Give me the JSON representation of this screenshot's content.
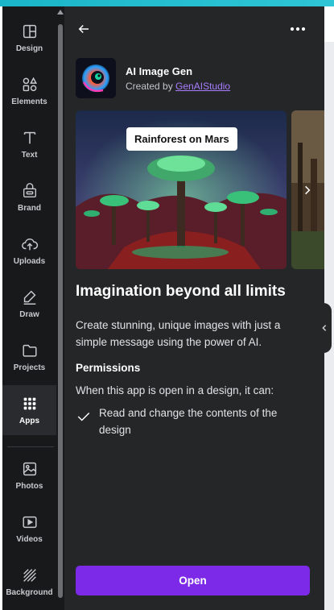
{
  "sidebar": {
    "items": [
      {
        "label": "Design",
        "icon": "layout-icon"
      },
      {
        "label": "Elements",
        "icon": "shapes-icon"
      },
      {
        "label": "Text",
        "icon": "text-t-icon"
      },
      {
        "label": "Brand",
        "icon": "brand-icon"
      },
      {
        "label": "Uploads",
        "icon": "cloud-upload-icon"
      },
      {
        "label": "Draw",
        "icon": "pen-icon"
      },
      {
        "label": "Projects",
        "icon": "folder-icon"
      },
      {
        "label": "Apps",
        "icon": "grid-dots-icon",
        "active": true
      },
      {
        "label": "Photos",
        "icon": "image-icon"
      },
      {
        "label": "Videos",
        "icon": "video-icon"
      },
      {
        "label": "Background",
        "icon": "hatch-icon"
      }
    ]
  },
  "panel": {
    "back_icon": "arrow-left-icon",
    "more_icon": "more-horizontal-icon",
    "app": {
      "name": "AI Image Gen",
      "created_by_prefix": "Created by",
      "creator": "GenAIStudio"
    },
    "hero": {
      "caption": "Rainforest on Mars"
    },
    "headline": "Imagination beyond all limits",
    "description": "Create stunning, unique images with just a simple message using the power of AI.",
    "permissions": {
      "title": "Permissions",
      "intro": "When this app is open in a design, it can:",
      "items": [
        "Read and change the contents of the design"
      ]
    },
    "open_label": "Open"
  },
  "colors": {
    "panel_bg": "#252627",
    "sidebar_bg": "#18191b",
    "accent": "#7d2ae8",
    "link": "#a87dff",
    "top_bar": "#1bb5c9"
  }
}
